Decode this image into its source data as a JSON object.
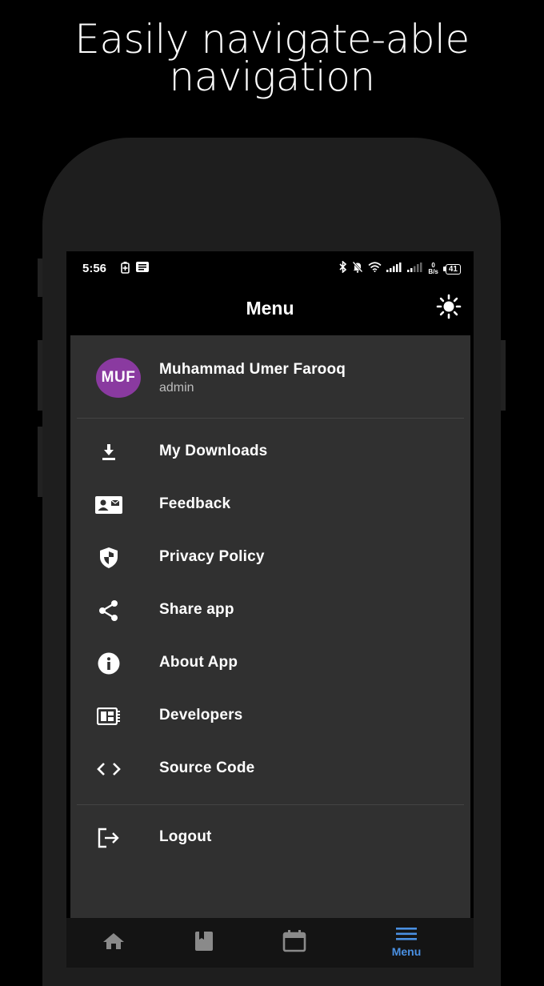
{
  "headline": {
    "line1": "Easily navigate-able",
    "line2": "navigation"
  },
  "status_bar": {
    "time": "5:56",
    "net_speed_value": "0",
    "net_speed_unit": "B/s",
    "battery": "41"
  },
  "app_bar": {
    "title": "Menu",
    "theme_toggle_icon": "sun-icon"
  },
  "profile": {
    "initials": "MUF",
    "name": "Muhammad Umer Farooq",
    "role": "admin",
    "avatar_color": "#8a3aa0"
  },
  "menu": {
    "items": [
      {
        "label": "My Downloads",
        "icon": "download-icon"
      },
      {
        "label": "Feedback",
        "icon": "contact-card-icon"
      },
      {
        "label": "Privacy Policy",
        "icon": "shield-icon"
      },
      {
        "label": "Share app",
        "icon": "share-icon"
      },
      {
        "label": "About App",
        "icon": "info-icon"
      },
      {
        "label": "Developers",
        "icon": "developer-board-icon"
      },
      {
        "label": "Source Code",
        "icon": "code-icon"
      }
    ],
    "logout": {
      "label": "Logout",
      "icon": "logout-icon"
    }
  },
  "bottom_nav": {
    "items": [
      {
        "icon": "home-icon"
      },
      {
        "icon": "book-icon"
      },
      {
        "icon": "calendar-icon"
      },
      {
        "icon": "menu-icon",
        "label": "Menu",
        "active": true
      }
    ],
    "active_color": "#4a90e2"
  },
  "colors": {
    "background": "#000000",
    "drawer": "#303030",
    "phone_body": "#1e1e1e"
  }
}
